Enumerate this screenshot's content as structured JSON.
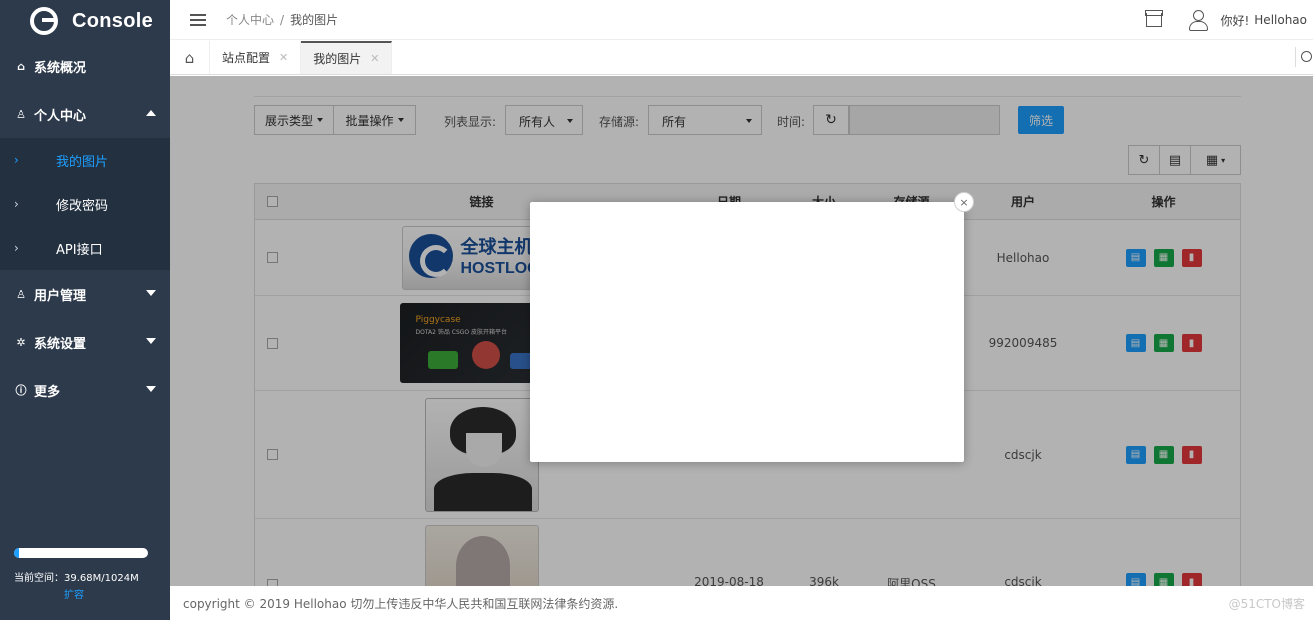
{
  "app": {
    "logo_text": "Console"
  },
  "sidebar": {
    "items": [
      {
        "label": "系统概况"
      },
      {
        "label": "个人中心"
      },
      {
        "label": "用户管理"
      },
      {
        "label": "系统设置"
      },
      {
        "label": "更多"
      }
    ],
    "subitems": [
      {
        "label": "我的图片"
      },
      {
        "label": "修改密码"
      },
      {
        "label": "API接口"
      }
    ],
    "storage": {
      "used_fraction": 0.039,
      "label": "当前空间：39.68M/1024M",
      "expand_label": "扩容"
    }
  },
  "header": {
    "breadcrumb": [
      "个人中心",
      "我的图片"
    ],
    "greeting": "你好!",
    "username": "Hellohao"
  },
  "tabs": [
    {
      "label": "站点配置"
    },
    {
      "label": "我的图片"
    }
  ],
  "toolbar": {
    "display_type_label": "展示类型",
    "batch_label": "批量操作",
    "list_display_label": "列表显示:",
    "list_display_value": "所有人",
    "storage_label": "存储源:",
    "storage_value": "所有",
    "time_label": "时间:",
    "filter_button": "筛选"
  },
  "table": {
    "headers": {
      "link": "链接",
      "date": "日期",
      "size": "大小",
      "storage": "存储源",
      "user": "用户",
      "ops": "操作"
    },
    "rows": [
      {
        "thumb_text": "全球主机",
        "thumb_text2": "HOSTLOC",
        "date": "",
        "size": "",
        "storage": "",
        "user": "Hellohao"
      },
      {
        "thumb_text": "Piggycase",
        "thumb_text2": "DOTA2 饰品 CSGO 皮肤开箱平台",
        "date": "",
        "size": "",
        "storage": "",
        "user": "992009485"
      },
      {
        "date": "",
        "size": "",
        "storage": "",
        "user": "cdscjk"
      },
      {
        "date": "2019-08-18",
        "size": "396k",
        "storage": "阿里OSS",
        "user": "cdscjk"
      }
    ]
  },
  "modal": {
    "close_symbol": "×"
  },
  "footer": {
    "text": "copyright © 2019 Hellohao 切勿上传违反中华人民共和国互联网法律条约资源."
  },
  "watermark": "@51CTO博客"
}
